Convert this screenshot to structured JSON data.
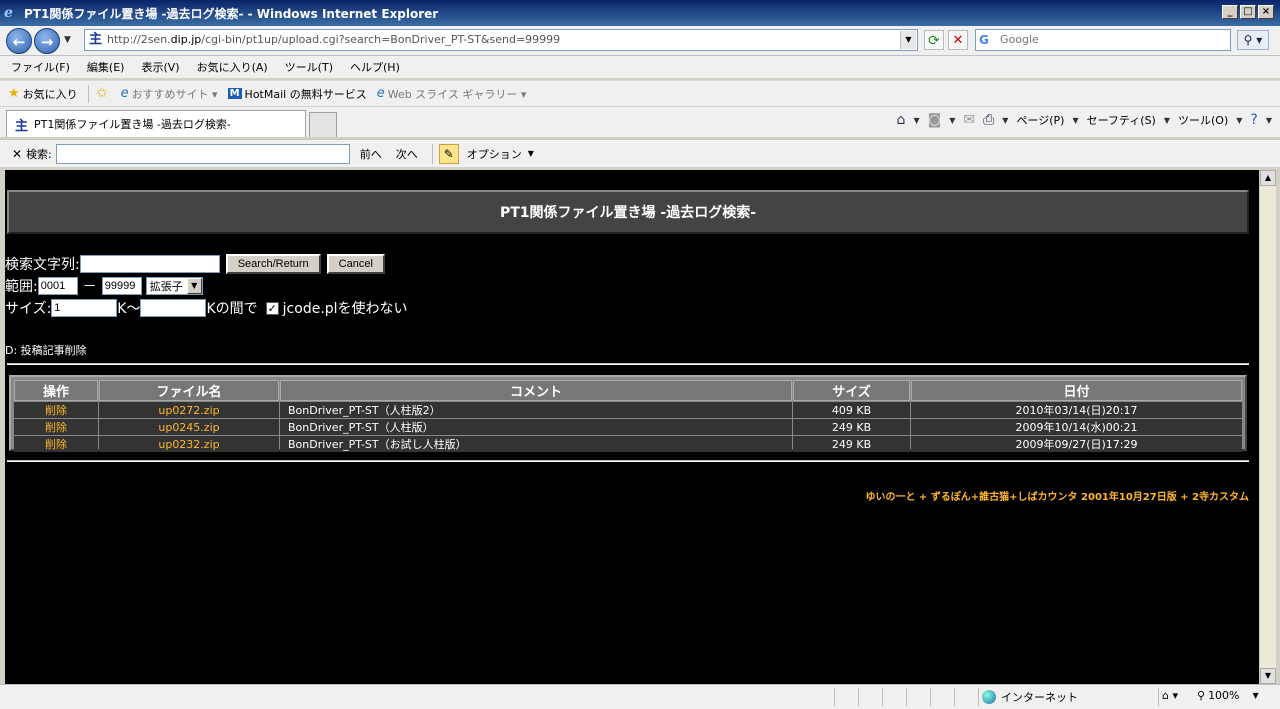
{
  "window": {
    "title": "PT1関係ファイル置き場 -過去ログ検索- - Windows Internet Explorer"
  },
  "nav": {
    "url_prefix": "http://2sen.",
    "url_host": "dip.jp",
    "url_rest": "/cgi-bin/pt1up/upload.cgi?search=BonDriver_PT-ST&send=99999",
    "search_placeholder": "Google"
  },
  "menu": {
    "items": [
      "ファイル(F)",
      "編集(E)",
      "表示(V)",
      "お気に入り(A)",
      "ツール(T)",
      "ヘルプ(H)"
    ]
  },
  "favorites": {
    "favorites_label": "お気に入り",
    "suggested": "おすすめサイト ▾",
    "hotmail": "HotMail の無料サービス",
    "webslice": "Web スライス ギャラリー ▾"
  },
  "tab": {
    "title": "PT1関係ファイル置き場 -過去ログ検索-"
  },
  "command_bar": {
    "page": "ページ(P)",
    "safety": "セーフティ(S)",
    "tools": "ツール(O)"
  },
  "find_bar": {
    "label": "検索:",
    "prev": "前へ",
    "next": "次へ",
    "options": "オプション"
  },
  "page": {
    "header": "PT1関係ファイル置き場 -過去ログ検索-",
    "search_label": "検索文字列:",
    "search_button": "Search/Return",
    "cancel_button": "Cancel",
    "range_label": "範囲:",
    "range_from": "0001",
    "range_dash": "－",
    "range_to": "99999",
    "ext_select": "拡張子",
    "size_label": "サイズ:",
    "size_from": "1",
    "size_mid": "K～",
    "size_suffix": "Kの間で",
    "jcode_label": "jcode.plを使わない",
    "note": "D: 投稿記事削除",
    "footer": "ゆいの一と + ずるぽん+誰古猫+しばカウンタ 2001年10月27日版 + 2寺カスタム"
  },
  "table": {
    "headers": [
      "操作",
      "ファイル名",
      "コメント",
      "サイズ",
      "日付"
    ],
    "rows": [
      {
        "action": "削除",
        "file": "up0272.zip",
        "comment": "BonDriver_PT-ST（人柱版2）",
        "size": "409 KB",
        "date": "2010年03/14(日)20:17"
      },
      {
        "action": "削除",
        "file": "up0245.zip",
        "comment": "BonDriver_PT-ST（人柱版）",
        "size": "249 KB",
        "date": "2009年10/14(水)00:21"
      },
      {
        "action": "削除",
        "file": "up0232.zip",
        "comment": "BonDriver_PT-ST（お試し人柱版）",
        "size": "249 KB",
        "date": "2009年09/27(日)17:29"
      }
    ]
  },
  "status": {
    "zone": "インターネット",
    "zoom": "100%"
  }
}
